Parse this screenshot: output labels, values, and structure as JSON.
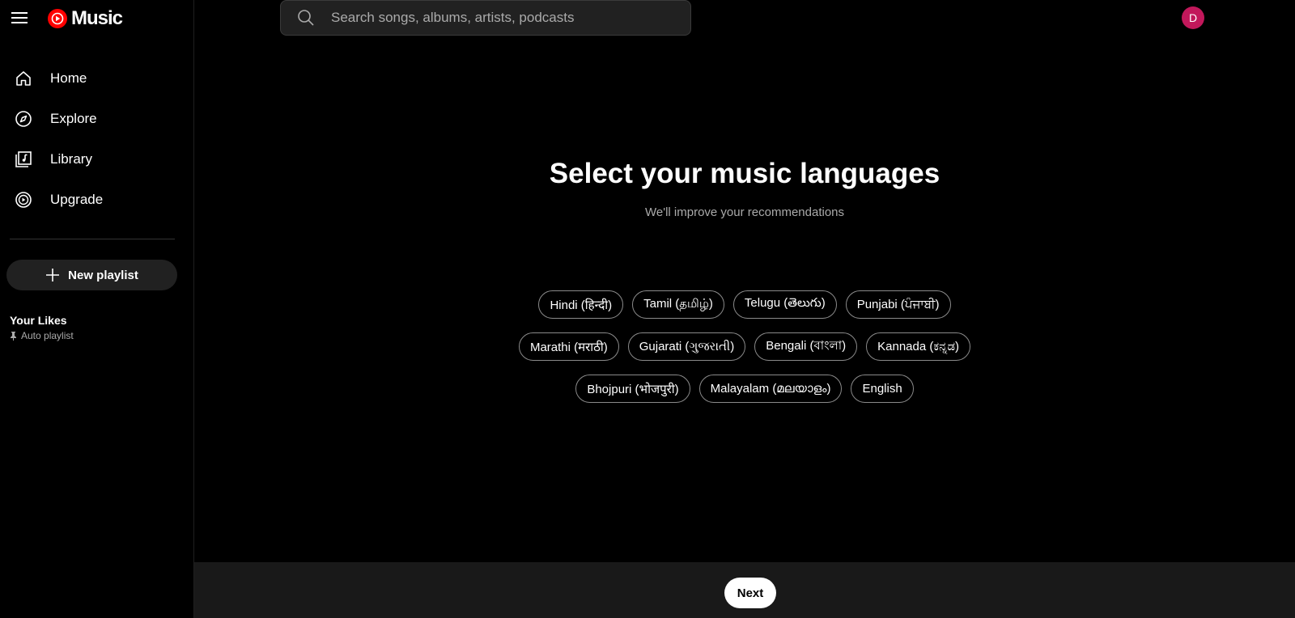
{
  "app": {
    "logo_text": "Music",
    "brand_color": "#ff0000"
  },
  "sidebar": {
    "items": [
      {
        "label": "Home",
        "icon": "home-icon"
      },
      {
        "label": "Explore",
        "icon": "compass-icon"
      },
      {
        "label": "Library",
        "icon": "library-icon"
      },
      {
        "label": "Upgrade",
        "icon": "upgrade-icon"
      }
    ],
    "new_playlist_label": "New playlist",
    "likes": {
      "title": "Your Likes",
      "subtitle": "Auto playlist"
    }
  },
  "search": {
    "placeholder": "Search songs, albums, artists, podcasts",
    "value": ""
  },
  "avatar": {
    "initial": "D",
    "color": "#c2185b"
  },
  "main": {
    "title": "Select your music languages",
    "subtitle": "We'll improve your recommendations",
    "languages": [
      [
        "Hindi (हिन्दी)",
        "Tamil (தமிழ்)",
        "Telugu (తెలుగు)",
        "Punjabi (ਪੰਜਾਬੀ)"
      ],
      [
        "Marathi (मराठी)",
        "Gujarati (ગુજરાતી)",
        "Bengali (বাংলা)",
        "Kannada (ಕನ್ನಡ)"
      ],
      [
        "Bhojpuri (भोजपुरी)",
        "Malayalam (മലയാളം)",
        "English"
      ]
    ],
    "next_label": "Next"
  }
}
